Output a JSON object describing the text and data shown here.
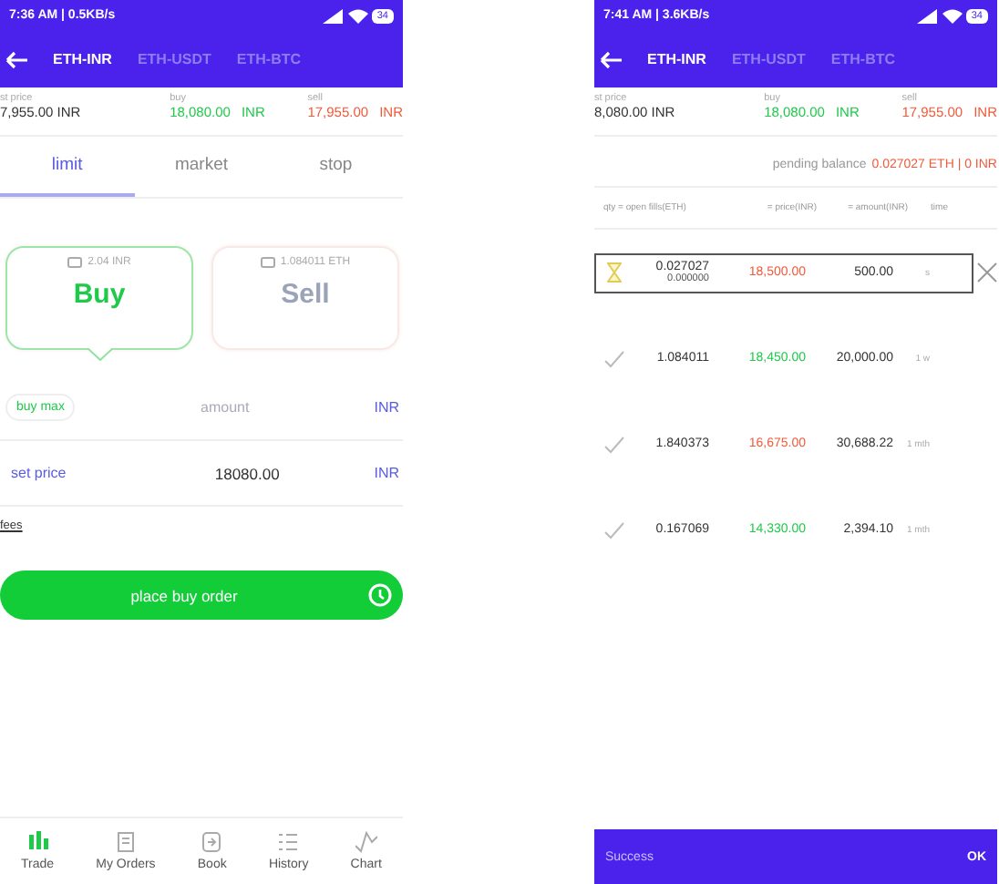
{
  "left_screen": {
    "status_bar": {
      "time": "7:36 AM | 0.5KB/s",
      "battery": "34"
    },
    "pair_tabs": [
      {
        "label": "ETH-INR",
        "selected": true
      },
      {
        "label": "ETH-USDT",
        "selected": false
      },
      {
        "label": "ETH-BTC",
        "selected": false
      }
    ],
    "ticker": [
      {
        "kind": "last",
        "label": "st price",
        "value": "7,955.00 INR"
      },
      {
        "kind": "buy",
        "label": "buy",
        "value": "18,080.00",
        "unit": "INR"
      },
      {
        "kind": "sell",
        "label": "sell",
        "value": "17,955.00",
        "unit": "INR"
      }
    ],
    "order_tabs": [
      {
        "label": "limit",
        "selected": true
      },
      {
        "label": "market",
        "selected": false
      },
      {
        "label": "stop",
        "selected": false
      }
    ],
    "side_cards": [
      {
        "kind": "buy",
        "balance": "2.04 INR",
        "label": "Buy",
        "selected": true
      },
      {
        "kind": "sell",
        "balance": "1.084011 ETH",
        "label": "Sell",
        "selected": false
      }
    ],
    "amount_row": {
      "chip": "buy max",
      "placeholder": "amount",
      "unit": "INR"
    },
    "price_row": {
      "label": "set price",
      "value": "18080.00",
      "unit": "INR"
    },
    "fees": "fees",
    "submit": "place buy order",
    "nav": [
      {
        "label": "Trade",
        "selected": true
      },
      {
        "label": "My Orders",
        "selected": false
      },
      {
        "label": "Book",
        "selected": false
      },
      {
        "label": "History",
        "selected": false
      },
      {
        "label": "Chart",
        "selected": false
      }
    ]
  },
  "right_screen": {
    "status_bar": {
      "time": "7:41 AM | 3.6KB/s",
      "battery": "34"
    },
    "pair_tabs": [
      {
        "label": "ETH-INR",
        "selected": true
      },
      {
        "label": "ETH-USDT",
        "selected": false
      },
      {
        "label": "ETH-BTC",
        "selected": false
      }
    ],
    "ticker": [
      {
        "kind": "last",
        "label": "st price",
        "value": "8,080.00 INR"
      },
      {
        "kind": "buy",
        "label": "buy",
        "value": "18,080.00",
        "unit": "INR"
      },
      {
        "kind": "sell",
        "label": "sell",
        "value": "17,955.00",
        "unit": "INR"
      }
    ],
    "pending": {
      "label": "pending balance",
      "value": "0.027027 ETH | 0 INR"
    },
    "columns": [
      "qty = open fills(ETH)",
      "= price(INR)",
      "= amount(INR)",
      "time"
    ],
    "orders": [
      {
        "kind": "open",
        "color": "#f05a3a",
        "qty": "0.027027",
        "open": "0.000000",
        "price": "18,500.00",
        "amount": "500.00",
        "time": "s"
      },
      {
        "kind": "filled",
        "color": "#1fc94a",
        "qty": "1.084011",
        "price": "18,450.00",
        "amount": "20,000.00",
        "time": "1 w"
      },
      {
        "kind": "filled",
        "color": "#f05a3a",
        "qty": "1.840373",
        "price": "16,675.00",
        "amount": "30,688.22",
        "time": "1 mth"
      },
      {
        "kind": "filled",
        "color": "#1fc94a",
        "qty": "0.167069",
        "price": "14,330.00",
        "amount": "2,394.10",
        "time": "1 mth"
      }
    ],
    "snackbar": {
      "message": "Success",
      "action": "OK"
    }
  }
}
